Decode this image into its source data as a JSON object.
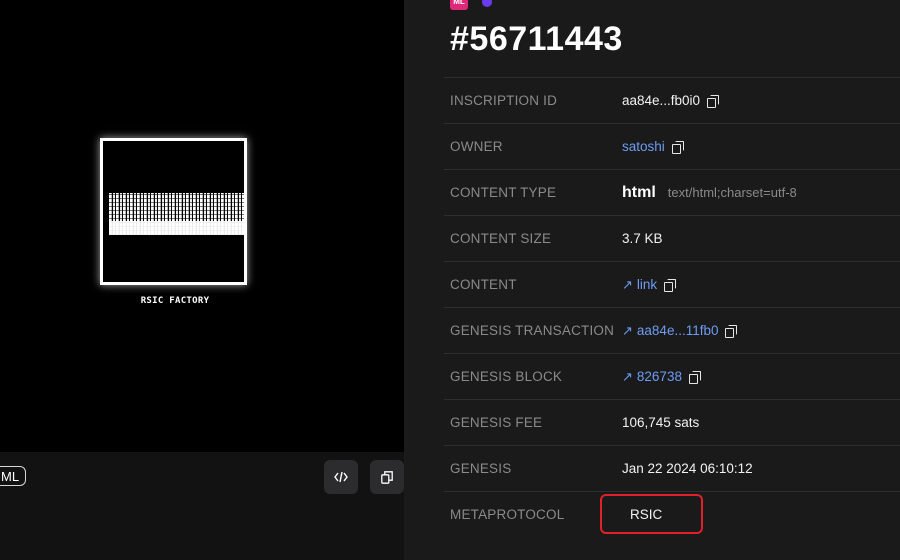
{
  "preview": {
    "caption": "RSIC FACTORY",
    "chip_label": "ML",
    "buttons": {
      "code_icon": "code-icon",
      "copy_icon": "copy-icon"
    }
  },
  "header": {
    "badge_text": "ML",
    "title": "#56711443"
  },
  "rows": [
    {
      "label": "INSCRIPTION ID",
      "value": "aa84e...fb0i0"
    },
    {
      "label": "OWNER",
      "value": "satoshi"
    },
    {
      "label": "CONTENT TYPE",
      "value": "html",
      "sub": "text/html;charset=utf-8"
    },
    {
      "label": "CONTENT SIZE",
      "value": "3.7 KB"
    },
    {
      "label": "CONTENT",
      "value": "link"
    },
    {
      "label": "GENESIS TRANSACTION",
      "value": "aa84e...11fb0"
    },
    {
      "label": "GENESIS BLOCK",
      "value": "826738"
    },
    {
      "label": "GENESIS FEE",
      "value": "106,745 sats"
    },
    {
      "label": "GENESIS",
      "value": "Jan 22 2024 06:10:12"
    },
    {
      "label": "METAPROTOCOL",
      "value": "RSIC"
    }
  ],
  "colors": {
    "link": "#6d9cf2",
    "highlight": "#e2202a",
    "badge": "#e0287b",
    "dot": "#6a3cf0"
  }
}
